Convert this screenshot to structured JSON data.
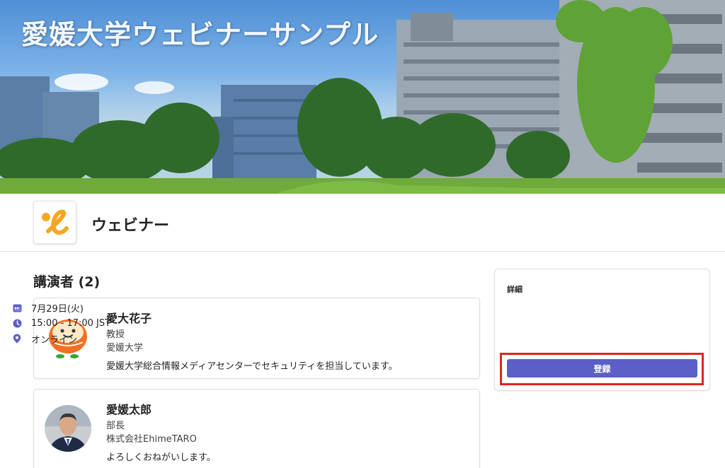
{
  "banner": {
    "title": "愛媛大学ウェビナーサンプル"
  },
  "header": {
    "title": "ウェビナー",
    "logo_icon": "ehime-e-logo-icon"
  },
  "speakers": {
    "heading": "講演者 (2)",
    "items": [
      {
        "name": "愛大花子",
        "role": "教授",
        "organization": "愛媛大学",
        "bio": "愛媛大学総合情報メディアセンターでセキュリティを担当しています。",
        "avatar_icon": "mikan-mascot-icon"
      },
      {
        "name": "愛媛太郎",
        "role": "部長",
        "organization": "株式会社EhimeTARO",
        "bio": "よろしくおねがいします。",
        "avatar_icon": "person-photo-icon"
      }
    ]
  },
  "details": {
    "heading": "詳細",
    "date": "7月29日(火)",
    "time": "15:00 - 17:00 JST",
    "location": "オンライン",
    "register_label": "登録",
    "icons": {
      "date": "calendar-icon",
      "time": "clock-icon",
      "location": "location-pin-icon"
    }
  },
  "colors": {
    "accent": "#5b5fc7",
    "highlight": "#e4231f",
    "logo_orange": "#f5a623"
  }
}
